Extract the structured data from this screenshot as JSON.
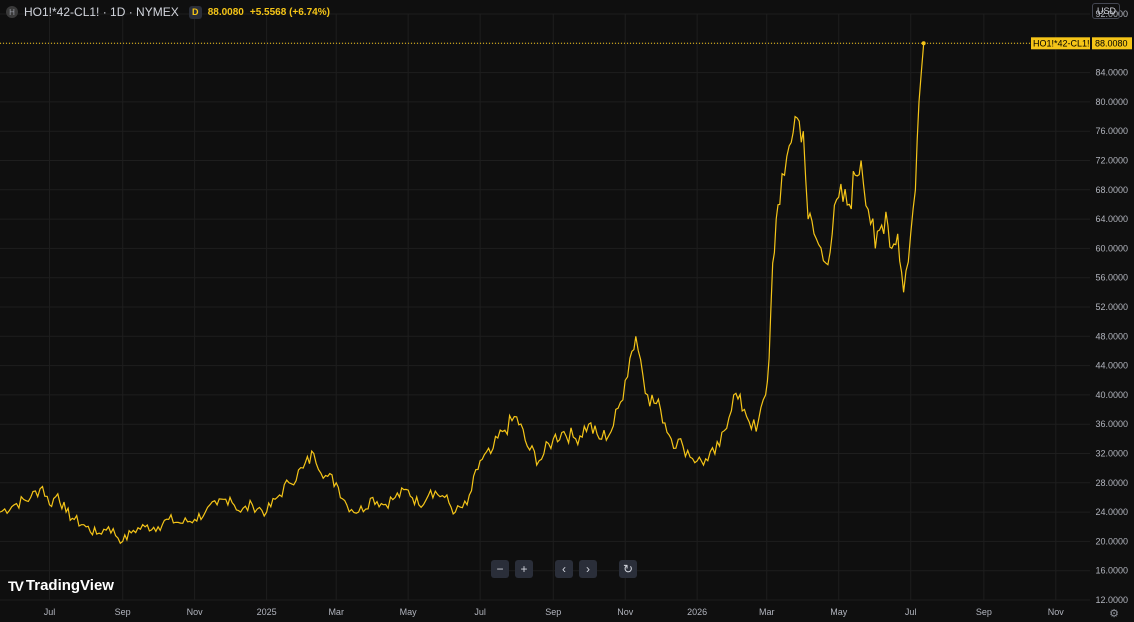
{
  "header": {
    "symbol_icon": "H",
    "title": "HO1!*42-CL1! · 1D · NYMEX",
    "interval_badge": "D",
    "last_value": "88.0080",
    "change": "+5.5568 (+6.74%)"
  },
  "currency_button": "USD",
  "toolbar": {
    "zoom_out_icon": "−",
    "zoom_in_icon": "+",
    "scroll_left_icon": "‹",
    "scroll_right_icon": "›",
    "reset_icon": "↻"
  },
  "logo": {
    "text": "TradingView",
    "mark": "TV"
  },
  "colors": {
    "background": "#0f0f0f",
    "line": "#f5c518",
    "grid": "#1e1e1e",
    "axis_text": "#b2b5be"
  },
  "chart_data": {
    "type": "line",
    "title": "HO1!*42-CL1! · 1D · NYMEX",
    "xlabel": "",
    "ylabel": "",
    "ylim": [
      12,
      92
    ],
    "grid": true,
    "x_ticks": [
      "Jul",
      "Sep",
      "Nov",
      "2025",
      "Mar",
      "May",
      "Jul",
      "Sep",
      "Nov",
      "2026",
      "Mar",
      "May",
      "Jul",
      "Sep",
      "Nov"
    ],
    "y_ticks": [
      "12.0000",
      "16.0000",
      "20.0000",
      "24.0000",
      "28.0000",
      "32.0000",
      "36.0000",
      "40.0000",
      "44.0000",
      "48.0000",
      "52.0000",
      "56.0000",
      "60.0000",
      "64.0000",
      "68.0000",
      "72.0000",
      "76.0000",
      "80.0000",
      "84.0000",
      "88.0000",
      "92.0000"
    ],
    "series": [
      {
        "name": "HO1!*42-CL1!",
        "x": [
          "2024-05-20",
          "2024-06-01",
          "2024-06-15",
          "2024-06-25",
          "2024-07-01",
          "2024-07-08",
          "2024-07-15",
          "2024-07-22",
          "2024-08-01",
          "2024-08-10",
          "2024-08-20",
          "2024-09-01",
          "2024-09-10",
          "2024-09-20",
          "2024-10-01",
          "2024-10-10",
          "2024-10-20",
          "2024-11-01",
          "2024-11-10",
          "2024-11-20",
          "2024-12-01",
          "2024-12-10",
          "2024-12-20",
          "2025-01-01",
          "2025-01-10",
          "2025-01-20",
          "2025-02-01",
          "2025-02-10",
          "2025-02-20",
          "2025-03-01",
          "2025-03-10",
          "2025-03-20",
          "2025-04-01",
          "2025-04-10",
          "2025-04-20",
          "2025-05-01",
          "2025-05-10",
          "2025-05-20",
          "2025-06-01",
          "2025-06-10",
          "2025-06-20",
          "2025-07-01",
          "2025-07-10",
          "2025-07-20",
          "2025-08-01",
          "2025-08-10",
          "2025-08-20",
          "2025-09-01",
          "2025-09-10",
          "2025-09-20",
          "2025-10-01",
          "2025-10-10",
          "2025-10-20",
          "2025-10-28",
          "2025-11-01",
          "2025-11-05",
          "2025-11-10",
          "2025-11-20",
          "2025-12-01",
          "2025-12-10",
          "2025-12-20",
          "2026-01-01",
          "2026-01-10",
          "2026-01-20",
          "2026-02-01",
          "2026-02-10",
          "2026-02-20",
          "2026-02-28",
          "2026-03-03",
          "2026-03-06",
          "2026-03-09",
          "2026-03-12",
          "2026-03-16",
          "2026-03-20",
          "2026-03-25",
          "2026-04-01",
          "2026-04-05",
          "2026-04-10",
          "2026-04-20",
          "2026-05-01",
          "2026-05-10",
          "2026-05-15",
          "2026-05-20",
          "2026-06-01",
          "2026-06-10",
          "2026-06-15",
          "2026-06-20",
          "2026-06-25",
          "2026-07-01",
          "2026-07-05",
          "2026-07-08",
          "2026-07-12"
        ],
        "values": [
          24,
          25,
          26,
          27.5,
          25,
          26.5,
          24,
          23,
          22,
          21,
          22,
          20,
          21.5,
          22,
          22,
          23,
          22.5,
          23,
          24,
          25,
          26,
          24,
          25,
          24,
          26,
          28,
          30,
          32,
          29,
          28,
          25,
          24,
          26,
          25,
          26,
          27,
          25,
          27,
          26,
          24,
          25,
          31,
          32,
          35,
          37,
          33,
          31,
          34,
          35,
          34,
          36,
          34,
          35,
          39,
          42,
          45,
          48,
          40,
          38,
          34,
          33,
          31,
          31,
          33,
          40,
          38,
          35,
          40,
          45,
          58,
          64,
          66,
          70,
          74,
          78,
          76,
          64,
          62,
          58,
          67,
          66,
          70,
          72,
          60,
          65,
          60,
          62,
          54,
          62,
          68,
          80,
          88
        ]
      }
    ]
  }
}
